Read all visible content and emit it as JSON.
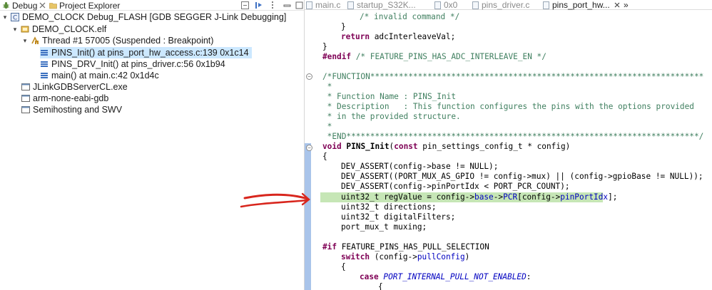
{
  "left_tabs": {
    "debug_label": "Debug",
    "project_label": "Project Explorer"
  },
  "tree": {
    "launch": "DEMO_CLOCK Debug_FLASH [GDB SEGGER J-Link Debugging]",
    "elf": "DEMO_CLOCK.elf",
    "thread": "Thread #1 57005 (Suspended : Breakpoint)",
    "frames": [
      "PINS_Init() at pins_port_hw_access.c:139 0x1c14",
      "PINS_DRV_Init() at pins_driver.c:56 0x1b94",
      "main() at main.c:42 0x1d4c"
    ],
    "processes": [
      "JLinkGDBServerCL.exe",
      "arm-none-eabi-gdb",
      "Semihosting and SWV"
    ]
  },
  "editor_tabs": [
    "main.c",
    "startup_S32K...",
    "0x0",
    "pins_driver.c",
    "pins_port_hw...",
    "»"
  ],
  "code": {
    "l1": "/* invalid command */",
    "l2": "}",
    "l3_kw": "return",
    "l3": " adcInterleaveVal;",
    "l4": "}",
    "l5_pp": "#endif",
    "l5": " /* FEATURE_PINS_HAS_ADC_INTERLEAVE_EN */",
    "l7": "/*FUNCTION**********************************************************************",
    "l8": " *",
    "l9": " * Function Name : PINS_Init",
    "l10": " * Description   : This function configures the pins with the options provided",
    "l11": " * in the provided structure.",
    "l12": " *",
    "l13": " *END**************************************************************************/",
    "sig_kw": "void",
    "sig_fn": "PINS_Init",
    "sig_paren": "(",
    "sig_const": "const",
    "sig_rest": " pin_settings_config_t * config)",
    "brace_open": "{",
    "a1": "DEV_ASSERT(config->base != NULL);",
    "a2": "DEV_ASSERT((PORT_MUX_AS_GPIO != config->mux) || (config->gpioBase != NULL));",
    "a3": "DEV_ASSERT(config->pinPortIdx < PORT_PCR_COUNT);",
    "hl_a": "uint32_t regValue = config->",
    "hl_b": "base",
    "hl_c": "->",
    "hl_d": "PCR",
    "hl_e": "[config->",
    "hl_f": "pinPortIdx",
    "hl_g": "];",
    "d1": "uint32_t directions;",
    "d2": "uint32_t digitalFilters;",
    "d3": "port_mux_t muxing;",
    "if_pp": "#if",
    "if_rest": " FEATURE_PINS_HAS_PULL_SELECTION",
    "sw_kw": "switch",
    "sw_a": " (config->",
    "sw_b": "pullConfig",
    "sw_c": ")",
    "b2": "{",
    "case_kw": "case",
    "case_val": "PORT_INTERNAL_PULL_NOT_ENABLED",
    "case_colon": ":",
    "b3": "{"
  },
  "colors": {
    "keyword": "#7f0055",
    "comment": "#3f7f5f",
    "field": "#0000c0",
    "current_line": "#c6e6b6",
    "selection": "#cce8ff",
    "annotation_arrow": "#d8261d"
  }
}
